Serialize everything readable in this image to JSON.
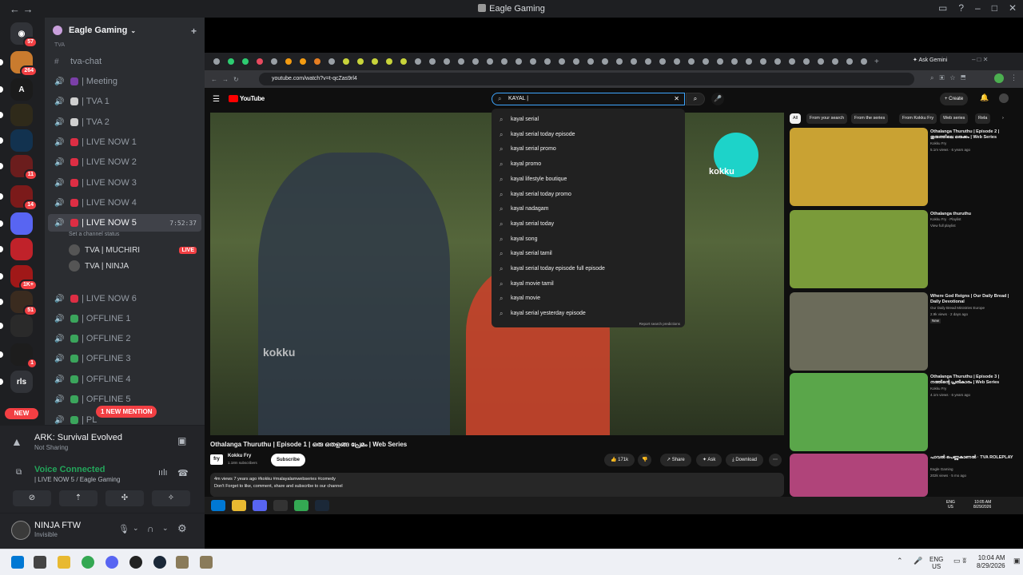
{
  "window": {
    "title": "Eagle Gaming",
    "nav_back": "←",
    "nav_forward": "→"
  },
  "guilds": {
    "home_badge": "57",
    "items": [
      {
        "badge": "264",
        "color": "#c97b2e"
      },
      {
        "badge": "",
        "color": "#1b1b1b",
        "glyph": "A"
      },
      {
        "badge": "",
        "color": "#2f2a1a"
      },
      {
        "badge": "",
        "color": "#12324f"
      },
      {
        "badge": "11",
        "color": "#6b1d1d"
      },
      {
        "badge": "14",
        "color": "#7b1a1a"
      },
      {
        "badge": "",
        "color": "#5865f2"
      },
      {
        "badge": "",
        "color": "#c0222a"
      },
      {
        "badge": "1K+",
        "color": "#a01818"
      },
      {
        "badge": "51",
        "color": "#3a2b1f"
      },
      {
        "badge": "",
        "color": "#2a2a2a"
      },
      {
        "badge": "1",
        "color": "#1d1d1d"
      },
      {
        "badge": "",
        "color": "#313338",
        "glyph": "rls"
      }
    ],
    "new_label": "NEW"
  },
  "server": {
    "name": "Eagle Gaming",
    "category": "TVA",
    "channels": [
      {
        "name": "tva-chat",
        "type": "text"
      },
      {
        "name": "| Meeting",
        "emoji_color": "#7b3fa8"
      },
      {
        "name": "| TVA 1",
        "emoji_color": "#cfcfcf"
      },
      {
        "name": "| TVA 2",
        "emoji_color": "#cfcfcf"
      },
      {
        "name": "| LIVE NOW 1",
        "emoji_color": "#dd2e44"
      },
      {
        "name": "| LIVE NOW 2",
        "emoji_color": "#dd2e44"
      },
      {
        "name": "| LIVE NOW 3",
        "emoji_color": "#dd2e44"
      },
      {
        "name": "| LIVE NOW 4",
        "emoji_color": "#dd2e44"
      },
      {
        "name": "| LIVE NOW 5",
        "emoji_color": "#dd2e44",
        "selected": true,
        "time": "7:52:37"
      },
      {
        "name": "| LIVE NOW 6",
        "emoji_color": "#dd2e44"
      },
      {
        "name": "| OFFLINE 1",
        "emoji_color": "#3ba55c"
      },
      {
        "name": "| OFFLINE 2",
        "emoji_color": "#3ba55c"
      },
      {
        "name": "| OFFLINE 3",
        "emoji_color": "#3ba55c"
      },
      {
        "name": "| OFFLINE 4",
        "emoji_color": "#3ba55c"
      },
      {
        "name": "| OFFLINE 5",
        "emoji_color": "#3ba55c"
      },
      {
        "name": "| PL",
        "emoji_color": "#3ba55c"
      }
    ],
    "set_status": "Set a channel status",
    "voice_users": [
      {
        "name": "TVA | MUCHIRI",
        "live": "LIVE"
      },
      {
        "name": "TVA | NINJA"
      }
    ],
    "mention": "1 NEW MENTION"
  },
  "activity": {
    "game": "ARK: Survival Evolved",
    "status": "Not Sharing"
  },
  "voice": {
    "title": "Voice Connected",
    "channel": "| LIVE NOW 5 / Eagle Gaming"
  },
  "user": {
    "name": "NINJA FTW",
    "status": "Invisible"
  },
  "chrome": {
    "url": "youtube.com/watch?v=t-qcZas9rl4",
    "ask_gemini": "Ask Gemini"
  },
  "youtube": {
    "logo": "YouTube",
    "search_value": "KAYAL |",
    "create": "+ Create",
    "suggestions": [
      "kayal serial",
      "kayal serial today episode",
      "kayal serial promo",
      "kayal promo",
      "kayal lifestyle boutique",
      "kayal serial today promo",
      "kayal nadagam",
      "kayal serial today",
      "kayal song",
      "kayal serial tamil",
      "kayal serial today episode full episode",
      "kayal movie tamil",
      "kayal movie",
      "kayal serial yesterday episode"
    ],
    "report": "Report search predictions",
    "video": {
      "title": "Othalanga Thuruthu | Episode 1 | ഒരു ഒതളങ്ങ പ്രേമം | Web Series",
      "channel": "Kokku Fry",
      "subs": "1.18m subscribers",
      "subscribe": "Subscribe",
      "likes": "171k",
      "share": "Share",
      "ask": "Ask",
      "download": "Download",
      "views": "4m views  7 years ago  #kokku #malayalamwebseries #comedy",
      "desc": "Don't Forget to like, comment, share and subscribe to our channel",
      "watermark": "kokku"
    },
    "chips": [
      "All",
      "From your search",
      "From the series",
      "From Kokku Fry",
      "Web series",
      "Rela"
    ],
    "recommendations": [
      {
        "title": "Othalanga Thuruthu | Episode 2 | തുരുത്തിലെ ഒരുക്കം | Web Series",
        "channel": "Kokku Fry",
        "meta": "5.1m views · 6 years ago",
        "color": "#c9a233"
      },
      {
        "title": "Othalanga thuruthu",
        "channel": "Kokku Fry · Playlist",
        "meta": "View full playlist",
        "color": "#7a9b3a"
      },
      {
        "title": "Where God Reigns | Our Daily Bread | Daily Devotional",
        "channel": "Our Daily Bread Ministries Europe",
        "meta": "2.9k views · 2 days ago",
        "color": "#6b6b5a",
        "badge": "New"
      },
      {
        "title": "Othalanga Thuruthu | Episode 3 | നത്തിന്റെ പ്രതികാരം | Web Series",
        "channel": "Kokku Fry",
        "meta": "4.1m views · 6 years ago",
        "color": "#5aa64a"
      },
      {
        "title": "പാവൽ പെണ്ണുകാണൽ · TVA ROLEPLAY",
        "channel": "Eagle Gaming",
        "meta": "202k views · 5 mo ago",
        "color": "#b0447a"
      }
    ]
  },
  "inner_taskbar": {
    "lang": "ENG",
    "region": "US",
    "time": "10:05 AM",
    "date": "8/29/2026"
  },
  "taskbar": {
    "lang": "ENG",
    "region": "US",
    "time": "10:04 AM",
    "date": "8/29/2026"
  }
}
